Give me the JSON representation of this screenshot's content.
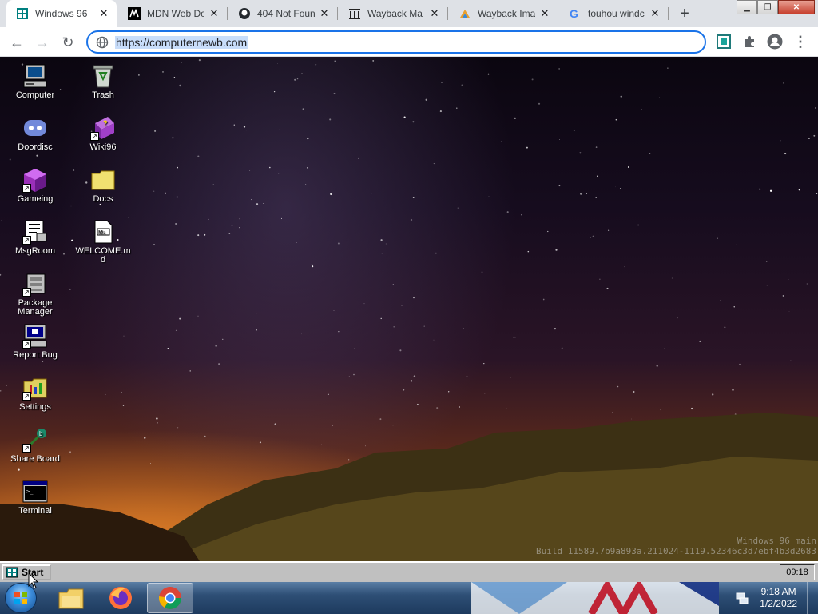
{
  "browser": {
    "tabs": [
      {
        "title": "Windows 96",
        "active": true,
        "favicon": "win96-icon"
      },
      {
        "title": "MDN Web Do",
        "active": false,
        "favicon": "mdn-icon"
      },
      {
        "title": "404 Not Foun",
        "active": false,
        "favicon": "github-icon"
      },
      {
        "title": "Wayback Ma",
        "active": false,
        "favicon": "archive-icon"
      },
      {
        "title": "Wayback Ima",
        "active": false,
        "favicon": "wayback-image-icon"
      },
      {
        "title": "touhou windc",
        "active": false,
        "favicon": "google-icon"
      }
    ],
    "url": "https://computernewb.com",
    "accent": "#1a73e8"
  },
  "desktop": {
    "icons": [
      {
        "label": "Computer",
        "icon": "computer-icon"
      },
      {
        "label": "Trash",
        "icon": "trash-icon"
      },
      {
        "label": "Doordisc",
        "icon": "discord-icon"
      },
      {
        "label": "Wiki96",
        "icon": "wiki-book-icon"
      },
      {
        "label": "Gameing",
        "icon": "cube-icon"
      },
      {
        "label": "Docs",
        "icon": "folder-icon"
      },
      {
        "label": "MsgRoom",
        "icon": "msgroom-icon"
      },
      {
        "label": "WELCOME.md",
        "icon": "markdown-file-icon"
      },
      {
        "label": "Package Manager",
        "icon": "package-icon"
      },
      {
        "label": "Report Bug",
        "icon": "bug-report-icon"
      },
      {
        "label": "Settings",
        "icon": "settings-folder-icon"
      },
      {
        "label": "Share Board",
        "icon": "share-board-icon"
      },
      {
        "label": "Terminal",
        "icon": "terminal-icon"
      }
    ],
    "watermark_line1": "Windows 96 main",
    "watermark_line2": "Build 11589.7b9a893a.211024-1119.52346c3d7ebf4b3d2683"
  },
  "win96_taskbar": {
    "start_label": "Start",
    "clock": "09:18"
  },
  "win7_taskbar": {
    "pinned": [
      "windows-start-orb",
      "file-explorer-icon",
      "firefox-icon",
      "chrome-icon"
    ],
    "time": "9:18 AM",
    "date": "1/2/2022"
  }
}
